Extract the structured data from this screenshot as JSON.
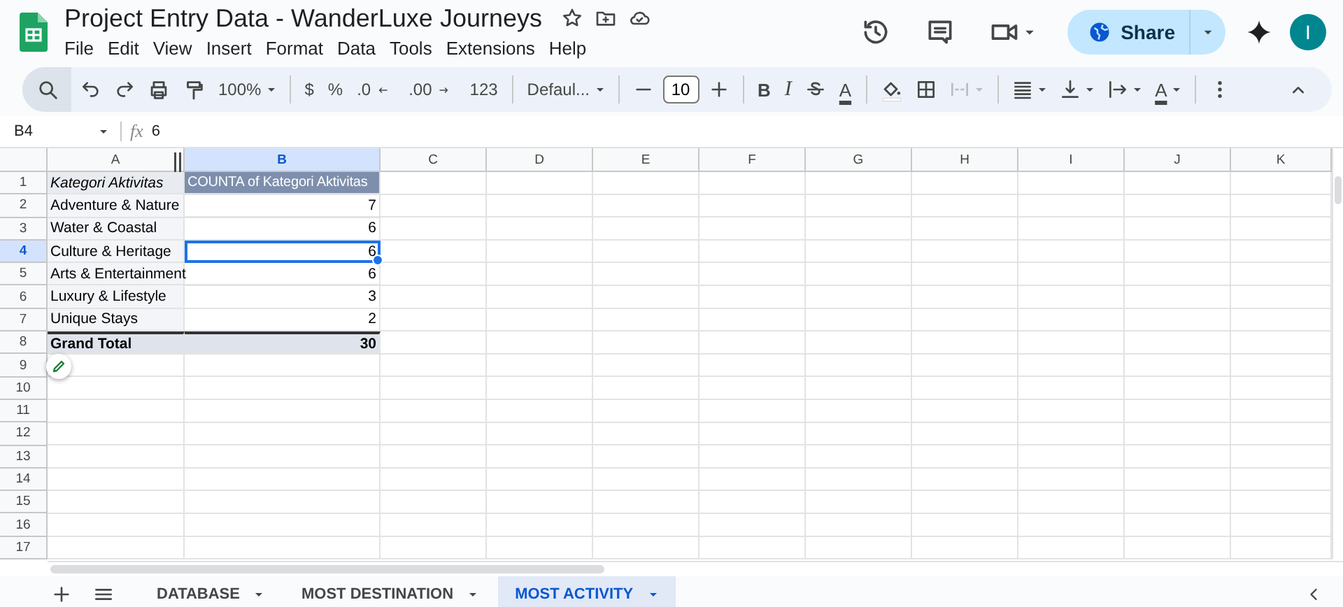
{
  "title": "Project Entry Data - WanderLuxe Journeys",
  "menu": [
    "File",
    "Edit",
    "View",
    "Insert",
    "Format",
    "Data",
    "Tools",
    "Extensions",
    "Help"
  ],
  "share": "Share",
  "avatar": "I",
  "toolbar": {
    "zoom": "100%",
    "currency": "$",
    "percent": "%",
    "decrease_decimals": ".0",
    "increase_decimals": ".00",
    "number_format": "123",
    "font": "Defaul...",
    "font_size": "10",
    "bold": "B",
    "italic": "I",
    "text_color": "A",
    "text_rotation": "A"
  },
  "name_box": "B4",
  "formula_label": "fx",
  "formula": "6",
  "columns": [
    {
      "label": "A",
      "selected": false
    },
    {
      "label": "B",
      "selected": true
    },
    {
      "label": "C",
      "selected": false
    },
    {
      "label": "D",
      "selected": false
    },
    {
      "label": "E",
      "selected": false
    },
    {
      "label": "F",
      "selected": false
    },
    {
      "label": "G",
      "selected": false
    },
    {
      "label": "H",
      "selected": false
    },
    {
      "label": "I",
      "selected": false
    },
    {
      "label": "J",
      "selected": false
    },
    {
      "label": "K",
      "selected": false
    }
  ],
  "rows": [
    {
      "number": "1",
      "kind": "header",
      "selected": false,
      "cells": [
        {
          "text": "Kategori Aktivitas",
          "selected": false
        },
        {
          "text": "COUNTA of Kategori Aktivitas",
          "selected": false
        }
      ]
    },
    {
      "number": "2",
      "kind": "data",
      "selected": false,
      "cells": [
        {
          "text": "Adventure & Nature",
          "selected": false
        },
        {
          "text": "7",
          "selected": false
        }
      ]
    },
    {
      "number": "3",
      "kind": "data",
      "selected": false,
      "cells": [
        {
          "text": "Water & Coastal",
          "selected": false
        },
        {
          "text": "6",
          "selected": false
        }
      ]
    },
    {
      "number": "4",
      "kind": "data",
      "selected": true,
      "cells": [
        {
          "text": "Culture & Heritage",
          "selected": false
        },
        {
          "text": "6",
          "selected": true
        }
      ]
    },
    {
      "number": "5",
      "kind": "data",
      "selected": false,
      "cells": [
        {
          "text": "Arts & Entertainment",
          "selected": false
        },
        {
          "text": "6",
          "selected": false
        }
      ]
    },
    {
      "number": "6",
      "kind": "data",
      "selected": false,
      "cells": [
        {
          "text": "Luxury & Lifestyle",
          "selected": false
        },
        {
          "text": "3",
          "selected": false
        }
      ]
    },
    {
      "number": "7",
      "kind": "data",
      "selected": false,
      "cells": [
        {
          "text": "Unique Stays",
          "selected": false
        },
        {
          "text": "2",
          "selected": false
        }
      ]
    },
    {
      "number": "8",
      "kind": "total",
      "selected": false,
      "cells": [
        {
          "text": "Grand Total",
          "selected": false
        },
        {
          "text": "30",
          "selected": false
        }
      ]
    },
    {
      "number": "9",
      "selected": false
    },
    {
      "number": "10",
      "selected": false
    },
    {
      "number": "11",
      "selected": false
    },
    {
      "number": "12",
      "selected": false
    },
    {
      "number": "13",
      "selected": false
    },
    {
      "number": "14",
      "selected": false
    },
    {
      "number": "15",
      "selected": false
    },
    {
      "number": "16",
      "selected": false
    },
    {
      "number": "17",
      "selected": false
    }
  ],
  "sheets": [
    {
      "label": "DATABASE",
      "selected": false
    },
    {
      "label": "MOST DESTINATION",
      "selected": false
    },
    {
      "label": "MOST ACTIVITY",
      "selected": true
    }
  ]
}
